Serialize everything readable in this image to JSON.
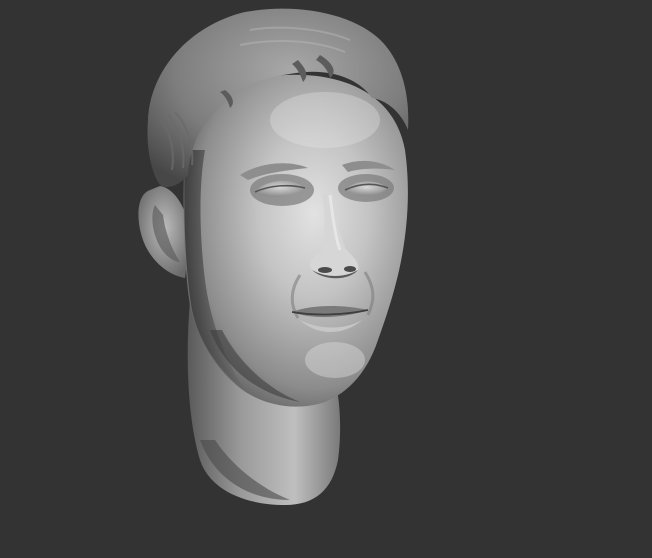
{
  "viewport": {
    "background_color": "#333333",
    "subject": "sculpted-head-model"
  },
  "model": {
    "material_base_color": "#9a9a9a",
    "highlight_color": "#e2e2e2",
    "shadow_color": "#3a3a3a"
  }
}
